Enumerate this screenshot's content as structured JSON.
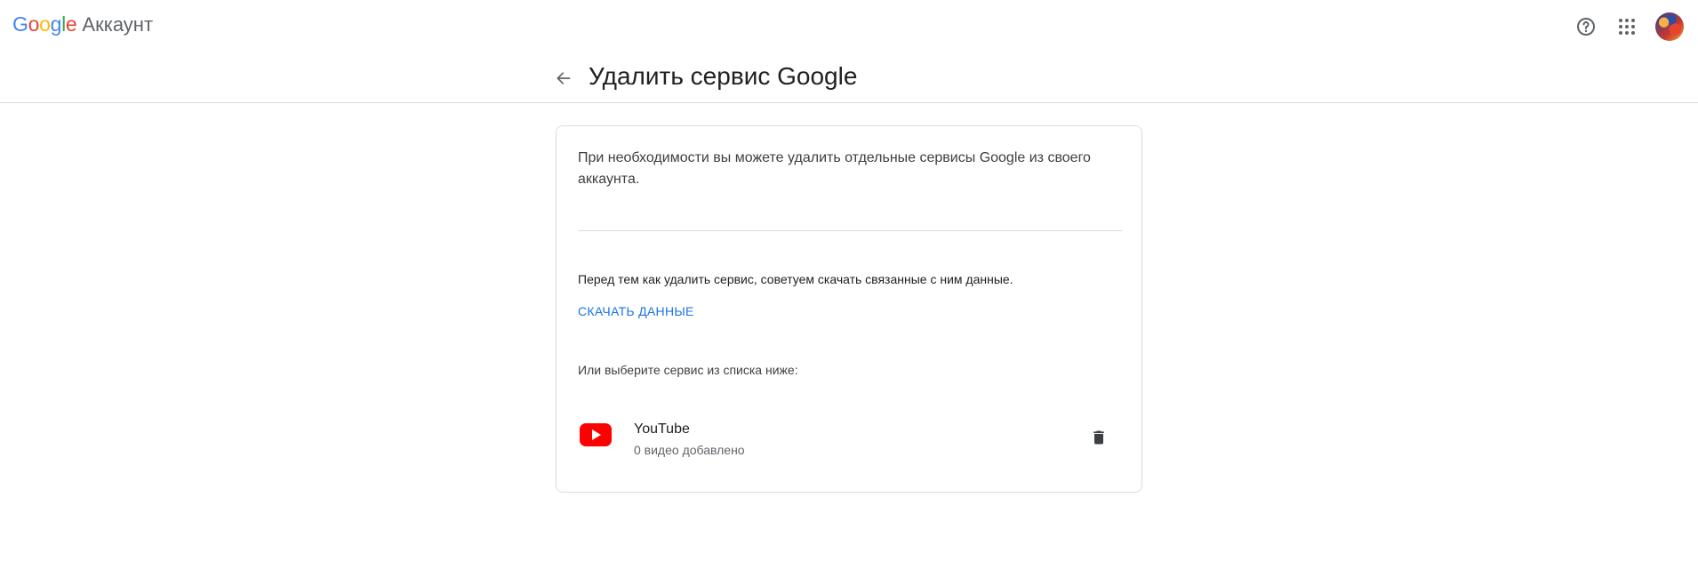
{
  "app": {
    "logo_letters": [
      {
        "char": "G",
        "color": "#4285F4"
      },
      {
        "char": "o",
        "color": "#EA4335"
      },
      {
        "char": "o",
        "color": "#FBBC05"
      },
      {
        "char": "g",
        "color": "#4285F4"
      },
      {
        "char": "l",
        "color": "#34A853"
      },
      {
        "char": "e",
        "color": "#EA4335"
      }
    ],
    "product": "Аккаунт"
  },
  "header": {
    "title": "Удалить сервис Google",
    "icons": [
      "back-arrow-icon",
      "help-icon",
      "apps-grid-icon",
      "avatar"
    ]
  },
  "card": {
    "intro": "При необходимости вы можете удалить отдельные сервисы Google из своего аккаунта.",
    "advice": "Перед тем как удалить сервис, советуем скачать связанные с ним данные.",
    "download_label": "СКАЧАТЬ ДАННЫЕ",
    "choose_label": "Или выберите сервис из списка ниже:",
    "services": [
      {
        "name": "YouTube",
        "subtitle": "0 видео добавлено",
        "icon": "youtube-icon",
        "action_icon": "trash-icon"
      }
    ]
  },
  "colors": {
    "accent": "#1a73e8",
    "youtube_red": "#FF0000",
    "divider": "#dadce0"
  }
}
